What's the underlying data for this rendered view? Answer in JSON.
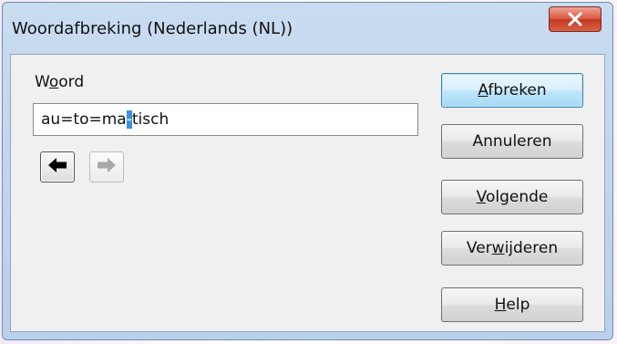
{
  "dialog": {
    "title": "Woordafbreking (Nederlands (NL))"
  },
  "word_field": {
    "label": "Woord",
    "value": "au=to=ma-tisch",
    "value_before_selection": "au=to=ma",
    "selected_char": "-",
    "value_after_selection": "tisch"
  },
  "navigation": {
    "previous_icon": "arrow-left-icon",
    "next_icon": "arrow-right-icon",
    "next_enabled": false
  },
  "buttons": {
    "hyphenate": "Afbreken",
    "cancel": "Annuleren",
    "next": "Volgende",
    "remove": "Verwijderen",
    "help": "Help"
  },
  "colors": {
    "selection": "#3f8fe0",
    "close_button": "#c9442a",
    "title_bar": "#c9dcf0"
  }
}
